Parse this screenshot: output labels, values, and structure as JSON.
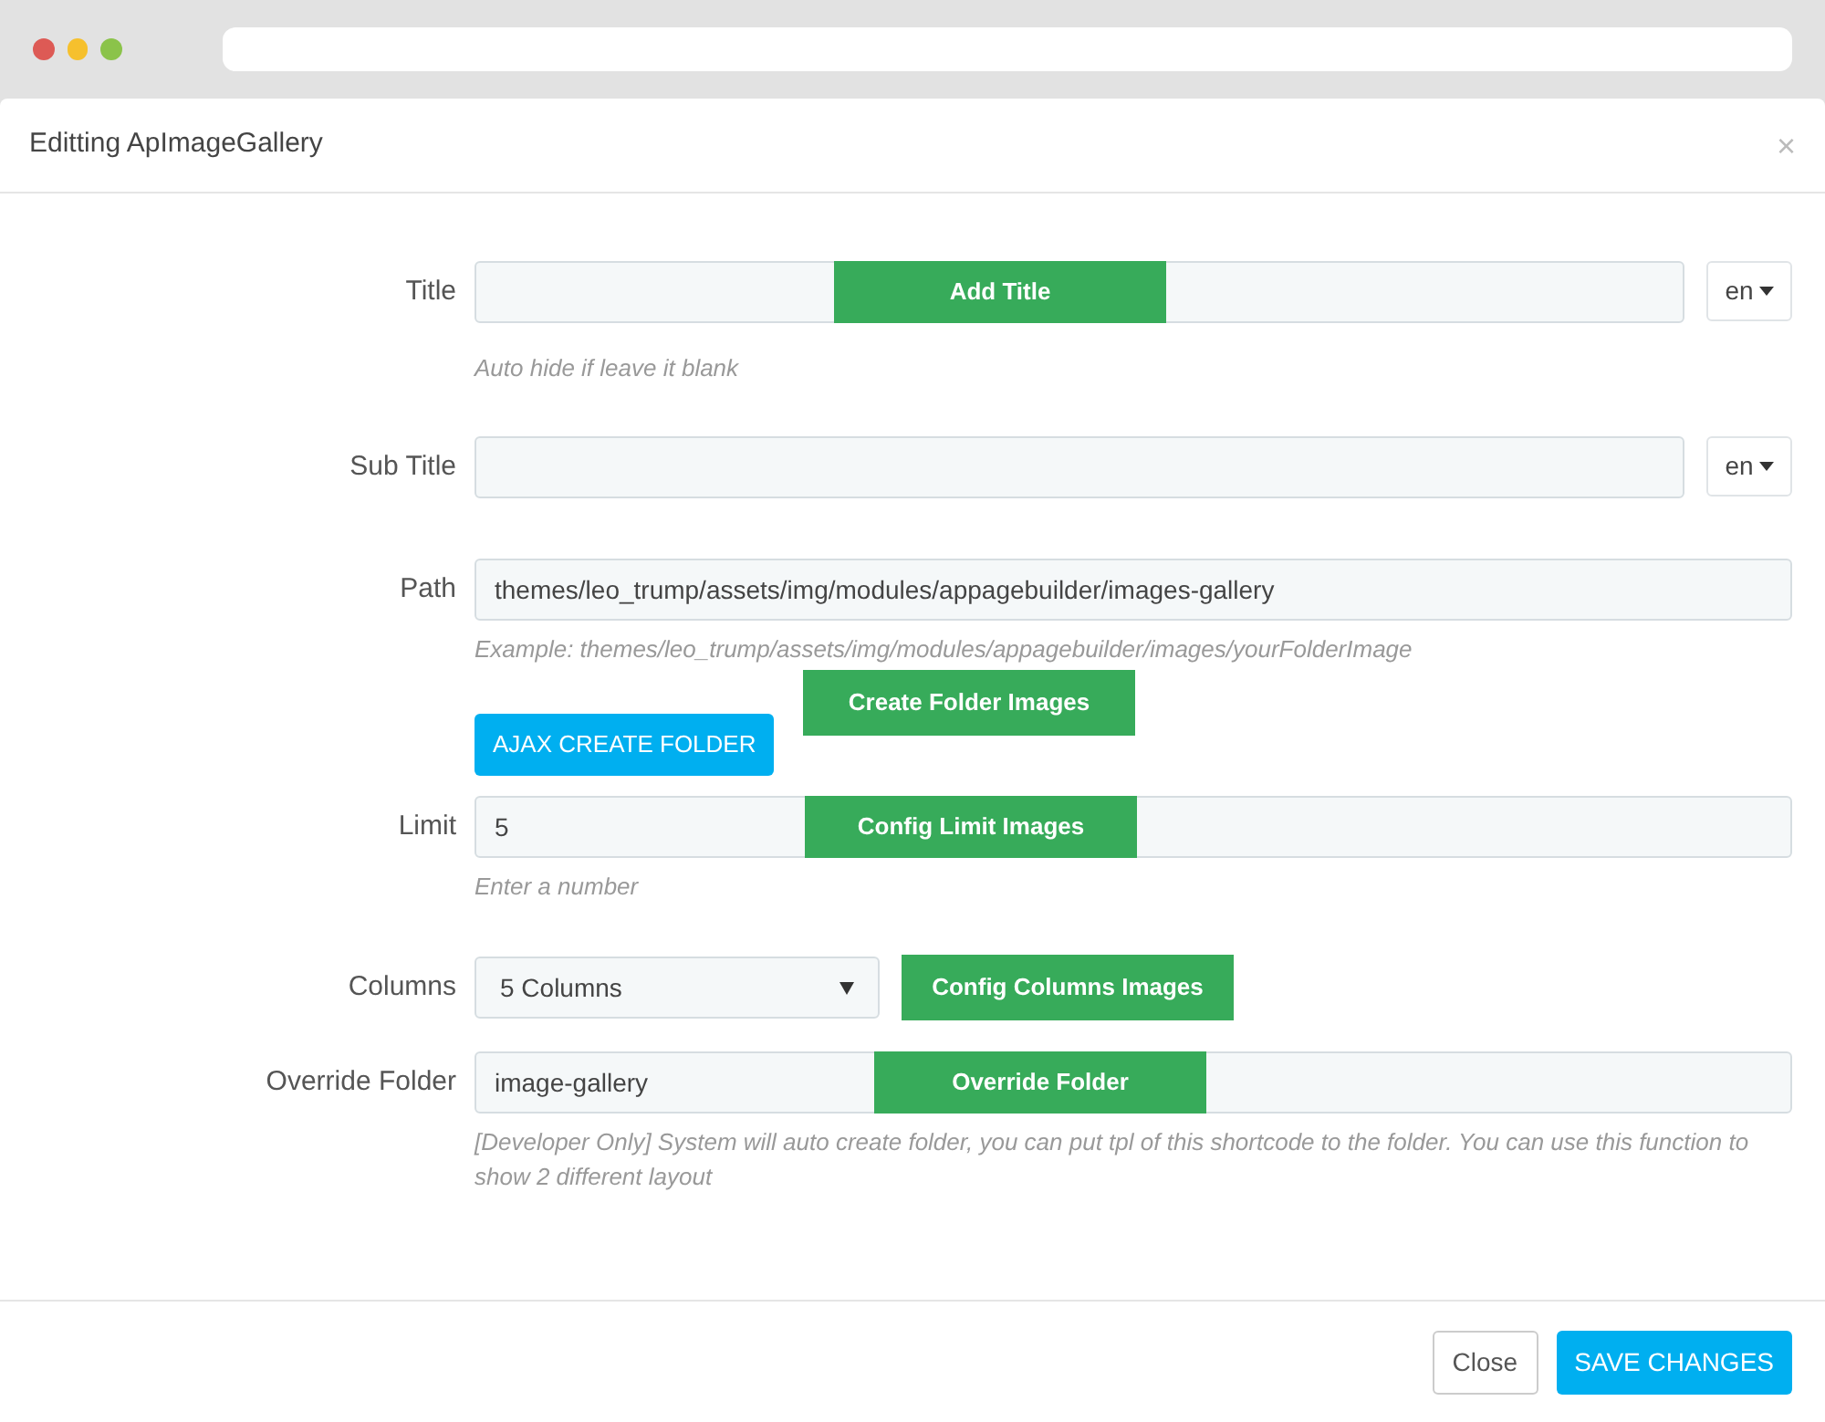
{
  "modal": {
    "title": "Editting ApImageGallery",
    "close": "×"
  },
  "fields": [
    {
      "kind": "text",
      "label": "Title",
      "lang": "en",
      "help": "Auto hide if leave it blank",
      "callout": "Add Title"
    },
    {
      "kind": "text",
      "label": "Sub Title",
      "lang": "en"
    },
    {
      "kind": "text",
      "label": "Path",
      "value": "themes/leo_trump/assets/img/modules/appagebuilder/images-gallery",
      "help": "Example: themes/leo_trump/assets/img/modules/appagebuilder/images/yourFolderImage",
      "action": {
        "label": "AJAX CREATE FOLDER",
        "callout": "Create Folder Images"
      }
    },
    {
      "kind": "text",
      "label": "Limit",
      "value": "5",
      "help": "Enter a number",
      "callout": "Config Limit Images"
    },
    {
      "kind": "select",
      "label": "Columns",
      "value": "5 Columns",
      "callout": "Config Columns Images"
    },
    {
      "kind": "text",
      "label": "Override Folder",
      "value": "image-gallery",
      "help": "[Developer Only] System will auto create folder, you can put tpl of this shortcode to the folder. You can use this function to show 2 different layout",
      "callout": "Override Folder"
    }
  ],
  "footer": {
    "buttons": [
      {
        "label": "Close",
        "kind": "default"
      },
      {
        "label": "SAVE CHANGES",
        "kind": "primary"
      }
    ]
  }
}
